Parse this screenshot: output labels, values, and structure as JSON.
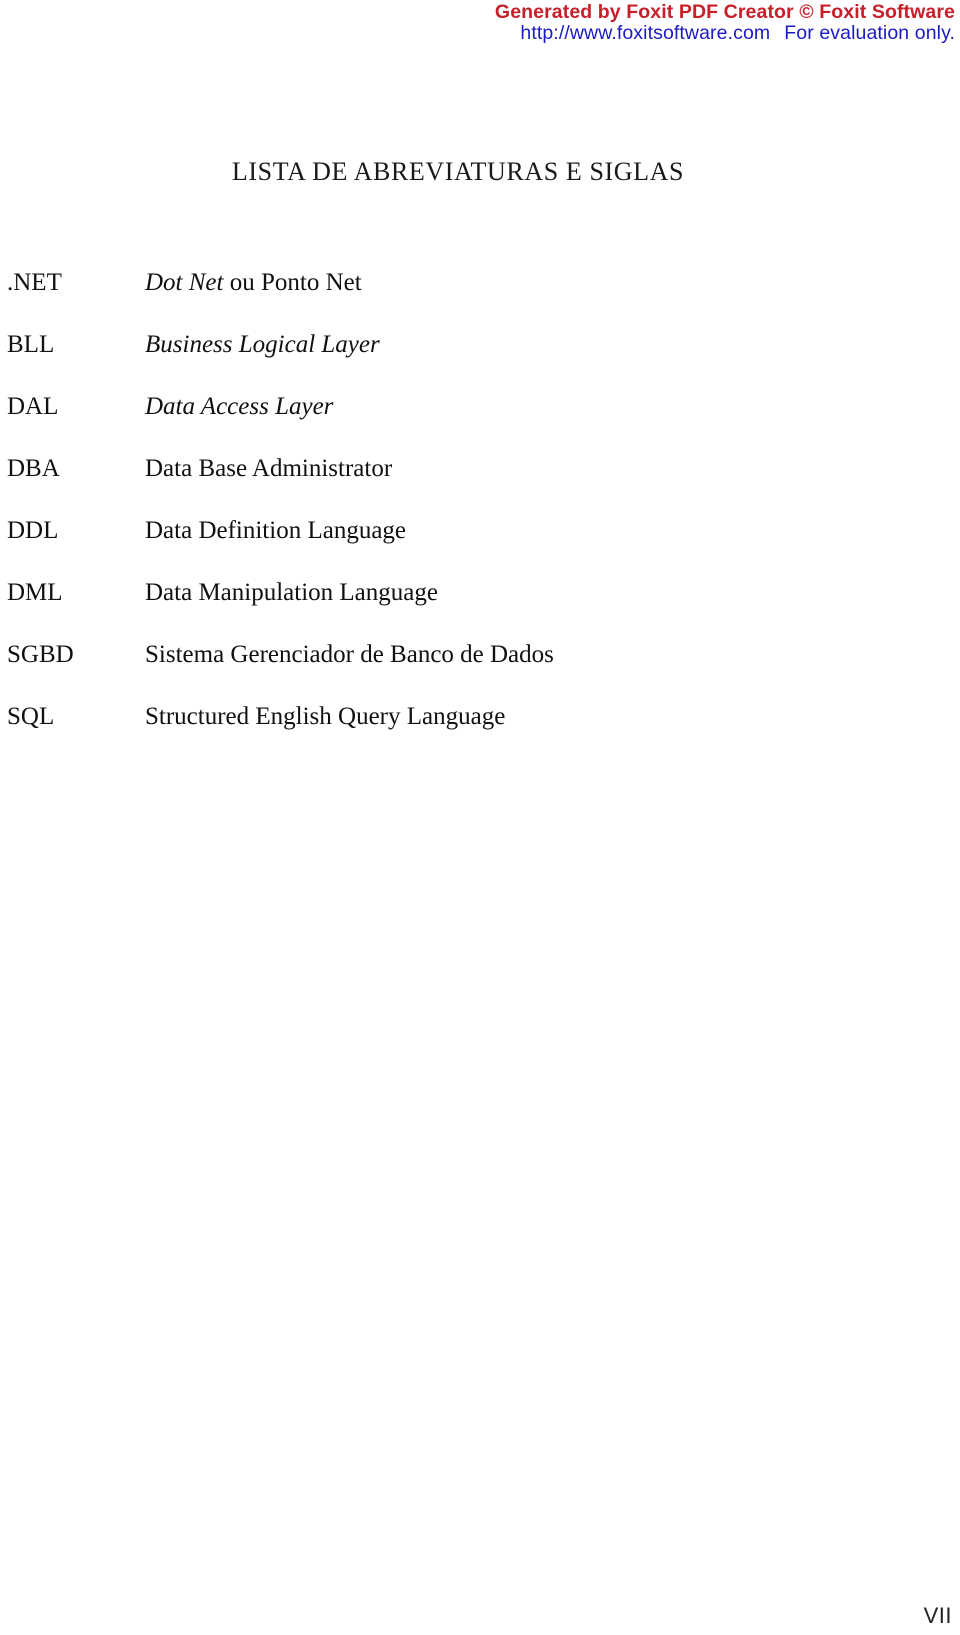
{
  "watermark": {
    "line1": "Generated by Foxit PDF Creator © Foxit Software",
    "line2_url": "http://www.foxitsoftware.com",
    "line2_note": "For evaluation only.",
    "color_line1": "#C8202A",
    "color_line2": "#1B1BC4"
  },
  "heading": {
    "title": "LISTA DE ABREVIATURAS E SIGLAS"
  },
  "abbreviations": [
    {
      "term": ".NET",
      "definition": "Dot Net ou Ponto Net",
      "def_italic_part": "Dot Net",
      "def_roman_part": " ou Ponto Net",
      "style": "mixed"
    },
    {
      "term": "BLL",
      "definition": "Business Logical Layer",
      "style": "italic"
    },
    {
      "term": "DAL",
      "definition": "Data Access Layer",
      "style": "italic"
    },
    {
      "term": "DBA",
      "definition": "Data Base Administrator",
      "style": "roman"
    },
    {
      "term": "DDL",
      "definition": "Data Definition Language",
      "style": "roman"
    },
    {
      "term": "DML",
      "definition": "Data Manipulation Language",
      "style": "roman"
    },
    {
      "term": "SGBD",
      "definition": "Sistema Gerenciador de Banco de Dados",
      "style": "roman"
    },
    {
      "term": "SQL",
      "definition": "Structured English Query Language",
      "style": "roman"
    }
  ],
  "footer": {
    "page_number": "VII"
  }
}
